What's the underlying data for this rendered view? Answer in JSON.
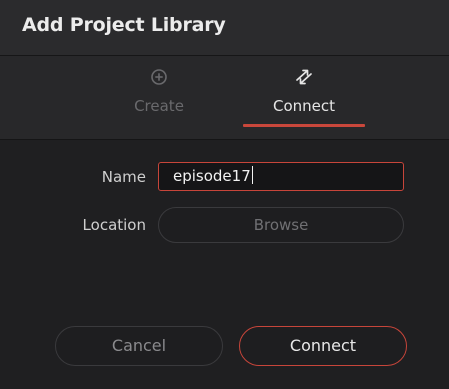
{
  "dialog": {
    "title": "Add Project Library"
  },
  "tabs": [
    {
      "label": "Create",
      "icon": "plus-circle-icon",
      "active": false
    },
    {
      "label": "Connect",
      "icon": "swap-arrows-icon",
      "active": true
    }
  ],
  "form": {
    "name_label": "Name",
    "name_value": "episode17",
    "location_label": "Location",
    "browse_label": "Browse"
  },
  "footer": {
    "cancel_label": "Cancel",
    "connect_label": "Connect"
  },
  "colors": {
    "accent": "#c7453a",
    "background": "#1f1f21",
    "header": "#2b2b2d"
  }
}
